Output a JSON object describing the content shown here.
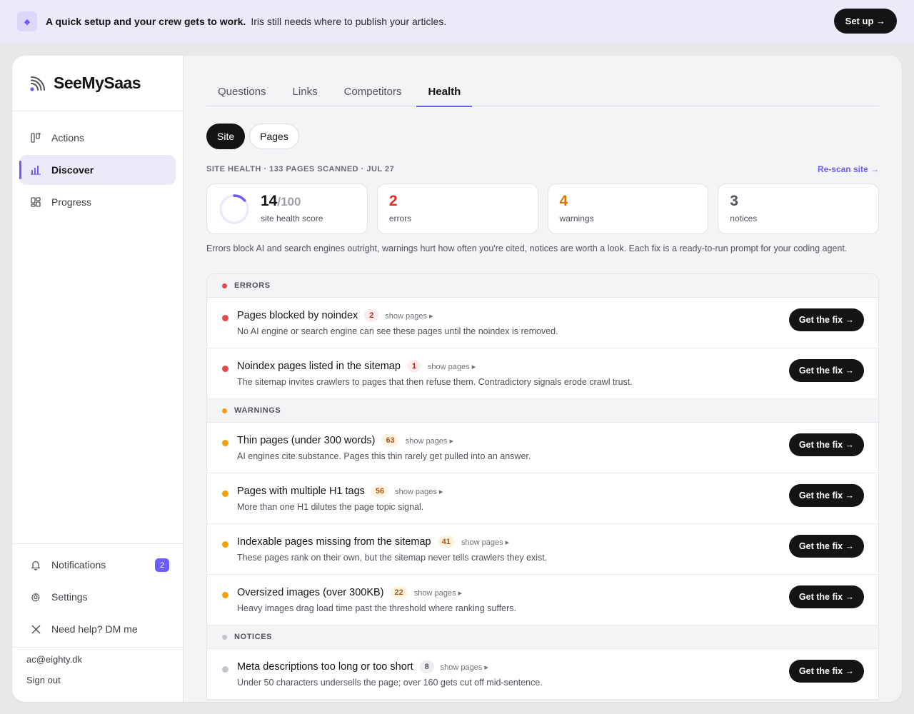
{
  "banner": {
    "icon": "diamond-icon",
    "bold": "A quick setup and your crew gets to work.",
    "text": "Iris still needs where to publish your articles.",
    "button": "Set up →"
  },
  "brand": {
    "name": "SeeMySaas",
    "icon": "rss-icon",
    "accent": "#6d5dfc"
  },
  "sidebar": {
    "items": [
      {
        "label": "Actions",
        "icon": "actions-icon",
        "active": false
      },
      {
        "label": "Discover",
        "icon": "bar-chart-icon",
        "active": true
      },
      {
        "label": "Progress",
        "icon": "grid-icon",
        "active": false
      }
    ],
    "bottom": [
      {
        "label": "Notifications",
        "icon": "bell-icon",
        "badge": "2"
      },
      {
        "label": "Settings",
        "icon": "gear-icon"
      },
      {
        "label": "Need help? DM me",
        "icon": "x-icon"
      }
    ],
    "email": "ac@eighty.dk",
    "signout": "Sign out"
  },
  "tabs": [
    "Questions",
    "Links",
    "Competitors",
    "Health"
  ],
  "active_tab": "Health",
  "segments": [
    "Site",
    "Pages"
  ],
  "active_segment": "Site",
  "scan": {
    "meta": "SITE HEALTH · 133 PAGES SCANNED · JUL 27",
    "rescan": "Re-scan site →"
  },
  "summary": {
    "score": "14",
    "score_max": "/100",
    "score_fraction": 0.14,
    "score_label": "site health score",
    "errors": "2",
    "errors_label": "errors",
    "warnings": "4",
    "warnings_label": "warnings",
    "notices": "3",
    "notices_label": "notices"
  },
  "explanation": "Errors block AI and search engines outright, warnings hurt how often you're cited, notices are worth a look. Each fix is a ready-to-run prompt for your coding agent.",
  "colors": {
    "error": "#e5484d",
    "warning": "#f59e0b",
    "notice": "#c4c4cc",
    "errorText": "#d92d20",
    "warningText": "#d97706",
    "noticeText": "#52525b"
  },
  "show_pages": "show pages ▸",
  "fix_label": "Get the fix →",
  "groups": [
    {
      "label": "ERRORS",
      "kind": "err",
      "issues": [
        {
          "title": "Pages blocked by noindex",
          "count": "2",
          "desc": "No AI engine or search engine can see these pages until the noindex is removed."
        },
        {
          "title": "Noindex pages listed in the sitemap",
          "count": "1",
          "desc": "The sitemap invites crawlers to pages that then refuse them. Contradictory signals erode crawl trust."
        }
      ]
    },
    {
      "label": "WARNINGS",
      "kind": "warn",
      "issues": [
        {
          "title": "Thin pages (under 300 words)",
          "count": "63",
          "desc": "AI engines cite substance. Pages this thin rarely get pulled into an answer."
        },
        {
          "title": "Pages with multiple H1 tags",
          "count": "56",
          "desc": "More than one H1 dilutes the page topic signal."
        },
        {
          "title": "Indexable pages missing from the sitemap",
          "count": "41",
          "desc": "These pages rank on their own, but the sitemap never tells crawlers they exist."
        },
        {
          "title": "Oversized images (over 300KB)",
          "count": "22",
          "desc": "Heavy images drag load time past the threshold where ranking suffers."
        }
      ]
    },
    {
      "label": "NOTICES",
      "kind": "note",
      "issues": [
        {
          "title": "Meta descriptions too long or too short",
          "count": "8",
          "desc": "Under 50 characters undersells the page; over 160 gets cut off mid-sentence."
        }
      ]
    }
  ]
}
